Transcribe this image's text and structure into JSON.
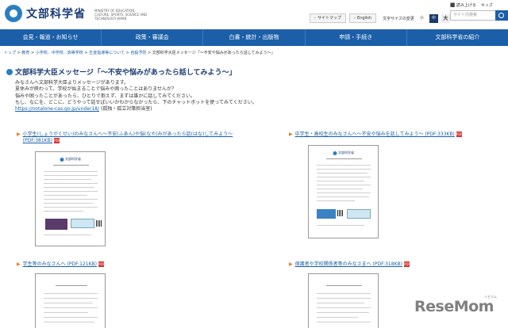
{
  "header": {
    "logo_text": "文部科学省",
    "logo_sub": "MINISTRY OF EDUCATION, CULTURE, SPORTS, SCIENCE AND TECHNOLOGY-JAPAN",
    "top_links": [
      "⬛ 読み上げる",
      "キッズ"
    ],
    "sitemap": "サイトマップ",
    "english": "English",
    "font_size_label": "文字サイズの変更",
    "font_small": "小",
    "font_mid": "中",
    "font_large": "大",
    "search_placeholder": "サイト内検索"
  },
  "nav": [
    "会見・報道・お知らせ",
    "政策・審議会",
    "白書・統計・出版物",
    "申請・手続き",
    "文部科学省の紹介"
  ],
  "breadcrumb": {
    "items": [
      "トップ",
      "教育",
      "小学校、中学校、高等学校",
      "生徒指導等について",
      "自殺予防",
      "文部科学大臣メッセージ「～不安や悩みがあったら話してみよう～」"
    ],
    "sep": " > "
  },
  "page": {
    "title": "文部科学大臣メッセージ「～不安や悩みがあったら話してみよう～」",
    "intro_lines": [
      "みなさんへ文部科学大臣よりメッセージがあります。",
      "夏休みが終わって、学校が始まることで悩みや困ったことはありませんか？",
      "悩みや困ったことがあったら、ひとりで抱えず、まずは誰かに話してみてください。",
      "もし、なにを、どこに、どうやって話せばいいかわからなかったら、下のチャットボットを使ってみてください。"
    ],
    "intro_link": "https://notalone-cas.go.jp/under18/",
    "intro_link_note": "(孤独・孤立対策担当室)"
  },
  "documents": [
    {
      "label": "小学生(しょうがくせい)のみなさんへ～不安(ふあん)や悩(なや)みがあったら話(はな)してみよう～ (PDF:381KB)",
      "thumb_logo": "文部科学省"
    },
    {
      "label": "中学生・高校生のみなさんへ～不安や悩みを話してみよう～ (PDF:333KB)",
      "thumb_logo": "文部科学省"
    },
    {
      "label": "学生等のみなさんへ (PDF:121KB)",
      "thumb_logo": ""
    },
    {
      "label": "保護者や学校関係者等のみなさまへ (PDF:318KB)",
      "thumb_logo": ""
    }
  ],
  "pdf_icon": "PDF",
  "watermark": "ReseMom",
  "watermark_sub": "リセマム",
  "icons": [
    "logo-mark-icon",
    "search-icon",
    "pdf-icon",
    "triangle-bullet-icon"
  ]
}
